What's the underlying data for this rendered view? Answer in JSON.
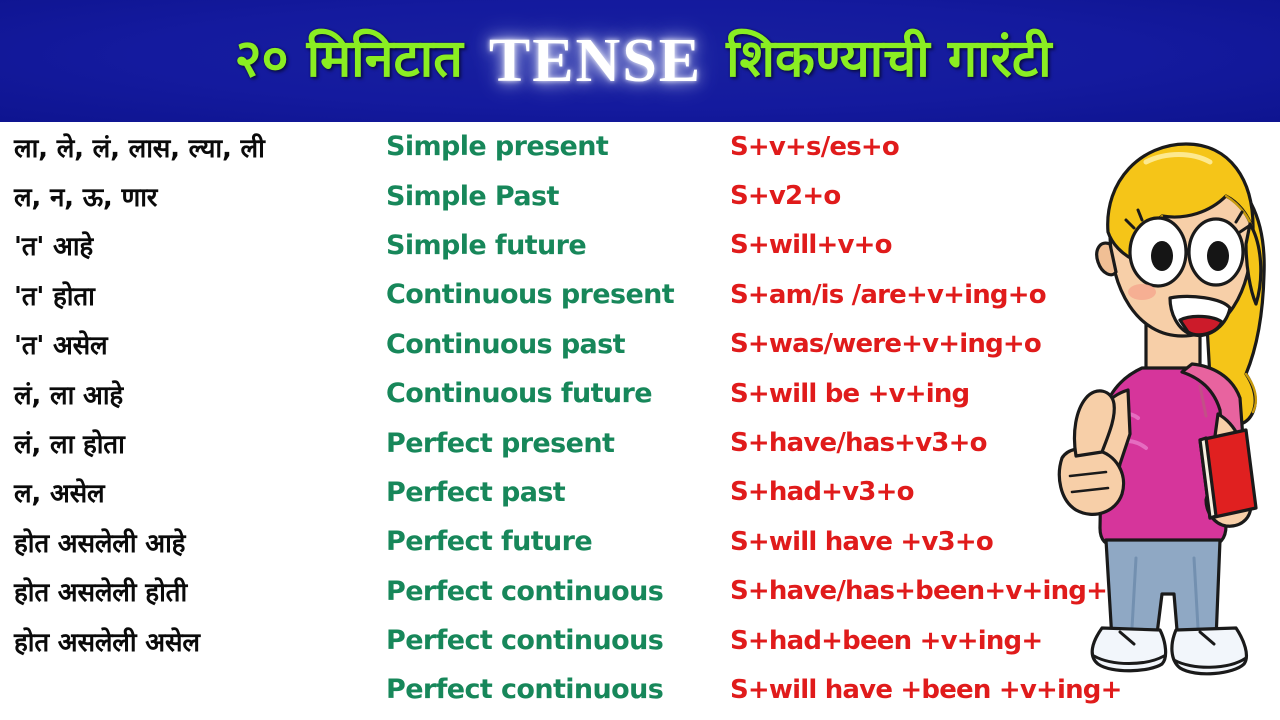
{
  "banner": {
    "marathi_left": "२० मिनिटात",
    "english_word": "TENSE",
    "marathi_right": "शिकण्याची गारंटी",
    "bg_color": "#141a9e",
    "marathi_color": "#8aee22",
    "english_color": "#ffffff"
  },
  "colors": {
    "marathi_text": "#0a0a0a",
    "tense_name": "#17875a",
    "formula": "#e01b1b",
    "page_bg": "#ffffff"
  },
  "table": {
    "rows": [
      {
        "marathi": "ला, ले, लं, लास, ल्या, ली",
        "tense": "Simple present",
        "formula": "S+v+s/es+o"
      },
      {
        "marathi": "ल, न, ऊ, णार",
        "tense": "Simple Past",
        "formula": "S+v2+o"
      },
      {
        "marathi": "'त' आहे",
        "tense": "Simple future",
        "formula": "S+will+v+o"
      },
      {
        "marathi": "'त' होता",
        "tense": "Continuous present",
        "formula": "S+am/is /are+v+ing+o"
      },
      {
        "marathi": "'त' असेल",
        "tense": "Continuous past",
        "formula": "S+was/were+v+ing+o"
      },
      {
        "marathi": "लं, ला आहे",
        "tense": "Continuous future",
        "formula": "S+will be +v+ing"
      },
      {
        "marathi": "लं, ला होता",
        "tense": "Perfect present",
        "formula": "S+have/has+v3+o"
      },
      {
        "marathi": "ल, असेल",
        "tense": "Perfect past",
        "formula": "S+had+v3+o"
      },
      {
        "marathi": "होत असलेली आहे",
        "tense": "Perfect future",
        "formula": "S+will have +v3+o"
      },
      {
        "marathi": "होत असलेली होती",
        "tense": "Perfect continuous",
        "formula": "S+have/has+been+v+ing+"
      },
      {
        "marathi": "होत असलेली असेल",
        "tense": "Perfect continuous",
        "formula": "S+had+been +v+ing+"
      },
      {
        "marathi": "",
        "tense": "Perfect continuous",
        "formula": "S+will have +been +v+ing+"
      }
    ]
  },
  "mascot": {
    "name": "cartoon-girl-thumbs-up",
    "hair_color": "#f5c518",
    "shirt_color": "#d6359b",
    "backpack_color": "#e8639f",
    "jeans_color": "#8fa8c4",
    "shoe_color": "#f2f6fb",
    "book_color": "#e02020",
    "skin_color": "#f7cfa8"
  }
}
